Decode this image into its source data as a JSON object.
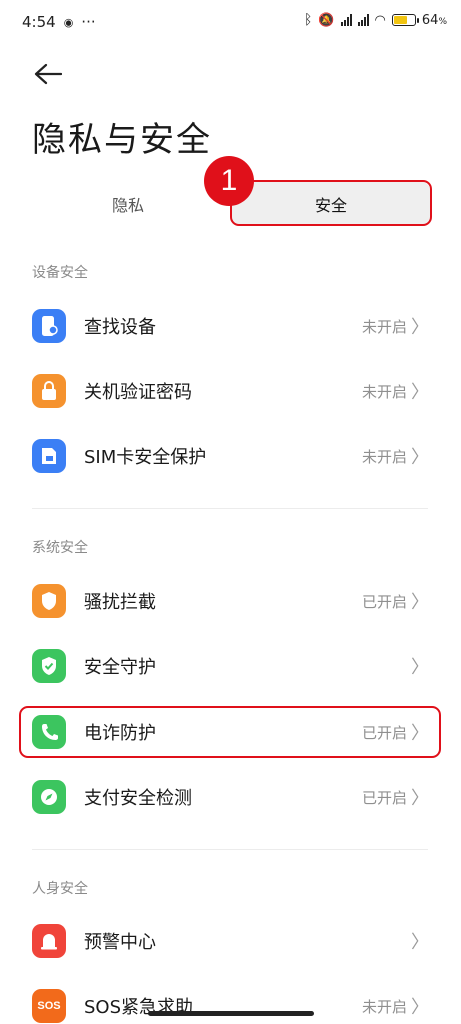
{
  "status_bar": {
    "time": "4:54",
    "dots": "···",
    "battery": "64",
    "battery_unit": "%",
    "battery_level": 0.64
  },
  "page": {
    "title": "隐私与安全"
  },
  "tabs": [
    {
      "label": "隐私"
    },
    {
      "label": "安全"
    }
  ],
  "annotation": {
    "step_number": "1"
  },
  "sections": [
    {
      "header": "设备安全",
      "items": [
        {
          "label": "查找设备",
          "value": "未开启",
          "icon": "find-device-icon",
          "color": "#3b7ff5"
        },
        {
          "label": "关机验证密码",
          "value": "未开启",
          "icon": "lock-icon",
          "color": "#f5922e"
        },
        {
          "label": "SIM卡安全保护",
          "value": "未开启",
          "icon": "sim-card-icon",
          "color": "#3b7ff5"
        }
      ]
    },
    {
      "header": "系统安全",
      "items": [
        {
          "label": "骚扰拦截",
          "value": "已开启",
          "icon": "shield-icon",
          "color": "#f5922e"
        },
        {
          "label": "安全守护",
          "value": "",
          "icon": "shield-check-icon",
          "color": "#3cc55f"
        },
        {
          "label": "电诈防护",
          "value": "已开启",
          "icon": "phone-icon",
          "color": "#3cc55f"
        },
        {
          "label": "支付安全检测",
          "value": "已开启",
          "icon": "compass-icon",
          "color": "#3cc55f"
        }
      ]
    },
    {
      "header": "人身安全",
      "items": [
        {
          "label": "预警中心",
          "value": "",
          "icon": "alarm-icon",
          "color": "#f0443a"
        },
        {
          "label": "SOS紧急求助",
          "value": "未开启",
          "icon": "sos-icon",
          "color": "#f26a1b",
          "icon_text": "SOS"
        }
      ]
    }
  ]
}
